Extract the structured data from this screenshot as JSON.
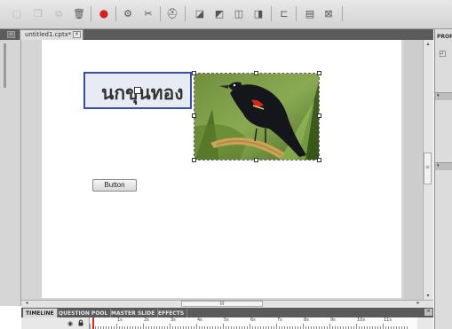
{
  "toolbar": {
    "icons": [
      "new-slide",
      "copy",
      "duplicate",
      "delete",
      "record",
      "effects",
      "scissors",
      "hat",
      "layers-1",
      "layers-2",
      "layers-3",
      "layers-4",
      "code",
      "grid",
      "expand"
    ]
  },
  "document": {
    "tab_title": "untitled1.cptx*",
    "close_glyph": "×",
    "collapse_glyph": "«"
  },
  "slide": {
    "caption_text": "นกขุนทอง",
    "button_label": "Button",
    "image_alt": "red-winged blackbird on reed"
  },
  "scrollbar": {
    "hthumb_glyph": "III",
    "left_glyph": "◂",
    "right_glyph": "▸",
    "vthumb_glyph": "≡",
    "up_glyph": "▴",
    "down_glyph": "▾"
  },
  "timeline": {
    "tabs": [
      "TIMELINE",
      "QUESTION POOL",
      "MASTER SLIDE",
      "EFFECTS"
    ],
    "ruler_labels": [
      "1s",
      "2s",
      "3s",
      "4s",
      "5s",
      "6s",
      "7s",
      "8s",
      "9s",
      "10s",
      "11s"
    ],
    "menu_glyph": "≡",
    "eye_glyph": "◉"
  },
  "properties": {
    "title": "PROPERTIES",
    "section1_glyph": "▾",
    "section2_glyph": "▾",
    "accent": "#3b4bb6",
    "playhead": "#e0281e"
  }
}
